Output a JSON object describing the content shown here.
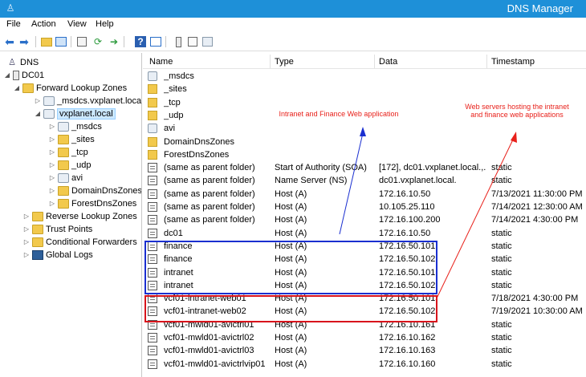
{
  "window": {
    "title": "DNS Manager"
  },
  "menu": [
    "File",
    "Action",
    "View",
    "Help"
  ],
  "toolbar": {
    "buttons": [
      "back-icon",
      "forward-icon",
      "up-folder-icon",
      "show-hide-tree-icon",
      "properties-icon",
      "refresh-icon",
      "export-list-icon",
      "help-icon",
      "console-tree-icon",
      "server-icon",
      "record-icon",
      "zone-icon"
    ]
  },
  "tree": [
    {
      "label": "DNS",
      "icon": "dns-icon",
      "toggle": "",
      "level": 0
    },
    {
      "label": "DC01",
      "icon": "server-icon",
      "toggle": "◢",
      "level": 1
    },
    {
      "label": "Forward Lookup Zones",
      "icon": "folder-icon",
      "toggle": "◢",
      "level": 2
    },
    {
      "label": "_msdcs.vxplanet.loca",
      "icon": "zone-icon",
      "toggle": "▷",
      "level": 3
    },
    {
      "label": "vxplanet.local",
      "icon": "zone-icon",
      "toggle": "◢",
      "level": 3,
      "selected": true
    },
    {
      "label": "_msdcs",
      "icon": "zone-icon",
      "toggle": "▷",
      "level": 4
    },
    {
      "label": "_sites",
      "icon": "folder-icon",
      "toggle": "▷",
      "level": 4
    },
    {
      "label": "_tcp",
      "icon": "folder-icon",
      "toggle": "▷",
      "level": 4
    },
    {
      "label": "_udp",
      "icon": "folder-icon",
      "toggle": "▷",
      "level": 4
    },
    {
      "label": "avi",
      "icon": "zone-icon",
      "toggle": "▷",
      "level": 4
    },
    {
      "label": "DomainDnsZones",
      "icon": "folder-icon",
      "toggle": "▷",
      "level": 4
    },
    {
      "label": "ForestDnsZones",
      "icon": "folder-icon",
      "toggle": "▷",
      "level": 4
    },
    {
      "label": "Reverse Lookup Zones",
      "icon": "folder-icon",
      "toggle": "▷",
      "level": 2
    },
    {
      "label": "Trust Points",
      "icon": "folder-icon",
      "toggle": "▷",
      "level": 2
    },
    {
      "label": "Conditional Forwarders",
      "icon": "folder-icon",
      "toggle": "▷",
      "level": 2
    },
    {
      "label": "Global Logs",
      "icon": "log-icon",
      "toggle": "▷",
      "level": 2
    }
  ],
  "columns": [
    "Name",
    "Type",
    "Data",
    "Timestamp"
  ],
  "rows": [
    {
      "name": "_msdcs",
      "type": "",
      "data": "",
      "timestamp": "",
      "icon": "zone"
    },
    {
      "name": "_sites",
      "type": "",
      "data": "",
      "timestamp": "",
      "icon": "folder"
    },
    {
      "name": "_tcp",
      "type": "",
      "data": "",
      "timestamp": "",
      "icon": "folder"
    },
    {
      "name": "_udp",
      "type": "",
      "data": "",
      "timestamp": "",
      "icon": "folder"
    },
    {
      "name": "avi",
      "type": "",
      "data": "",
      "timestamp": "",
      "icon": "zone"
    },
    {
      "name": "DomainDnsZones",
      "type": "",
      "data": "",
      "timestamp": "",
      "icon": "folder"
    },
    {
      "name": "ForestDnsZones",
      "type": "",
      "data": "",
      "timestamp": "",
      "icon": "folder"
    },
    {
      "name": "(same as parent folder)",
      "type": "Start of Authority (SOA)",
      "data": "[172], dc01.vxplanet.local.,...",
      "timestamp": "static",
      "icon": "record"
    },
    {
      "name": "(same as parent folder)",
      "type": "Name Server (NS)",
      "data": "dc01.vxplanet.local.",
      "timestamp": "static",
      "icon": "record"
    },
    {
      "name": "(same as parent folder)",
      "type": "Host (A)",
      "data": "172.16.10.50",
      "timestamp": "7/13/2021 11:30:00 PM",
      "icon": "record"
    },
    {
      "name": "(same as parent folder)",
      "type": "Host (A)",
      "data": "10.105.25.110",
      "timestamp": "7/14/2021 12:30:00 AM",
      "icon": "record"
    },
    {
      "name": "(same as parent folder)",
      "type": "Host (A)",
      "data": "172.16.100.200",
      "timestamp": "7/14/2021 4:30:00 PM",
      "icon": "record"
    },
    {
      "name": "dc01",
      "type": "Host (A)",
      "data": "172.16.10.50",
      "timestamp": "static",
      "icon": "record"
    },
    {
      "name": "finance",
      "type": "Host (A)",
      "data": "172.16.50.101",
      "timestamp": "static",
      "icon": "record"
    },
    {
      "name": "finance",
      "type": "Host (A)",
      "data": "172.16.50.102",
      "timestamp": "static",
      "icon": "record"
    },
    {
      "name": "intranet",
      "type": "Host (A)",
      "data": "172.16.50.101",
      "timestamp": "static",
      "icon": "record"
    },
    {
      "name": "intranet",
      "type": "Host (A)",
      "data": "172.16.50.102",
      "timestamp": "static",
      "icon": "record"
    },
    {
      "name": "vcf01-intranet-web01",
      "type": "Host (A)",
      "data": "172.16.50.101",
      "timestamp": "7/18/2021 4:30:00 PM",
      "icon": "record"
    },
    {
      "name": "vcf01-intranet-web02",
      "type": "Host (A)",
      "data": "172.16.50.102",
      "timestamp": "7/19/2021 10:30:00 AM",
      "icon": "record"
    },
    {
      "name": "vcf01-mwld01-avictrl01",
      "type": "Host (A)",
      "data": "172.16.10.161",
      "timestamp": "static",
      "icon": "record"
    },
    {
      "name": "vcf01-mwld01-avictrl02",
      "type": "Host (A)",
      "data": "172.16.10.162",
      "timestamp": "static",
      "icon": "record"
    },
    {
      "name": "vcf01-mwld01-avictrl03",
      "type": "Host (A)",
      "data": "172.16.10.163",
      "timestamp": "static",
      "icon": "record"
    },
    {
      "name": "vcf01-mwld01-avictrlvip01",
      "type": "Host (A)",
      "data": "172.16.10.160",
      "timestamp": "static",
      "icon": "record"
    }
  ],
  "annotations": {
    "blue_label": "Intranet and Finance Web application",
    "red_label_line1": "Web servers hosting the intranet",
    "red_label_line2": "and finance web applications"
  },
  "colors": {
    "titlebar": "#1e90d8",
    "highlight_blue": "#1a2fd0",
    "highlight_red": "#d8141c",
    "annotation_text": "#e8201a"
  }
}
